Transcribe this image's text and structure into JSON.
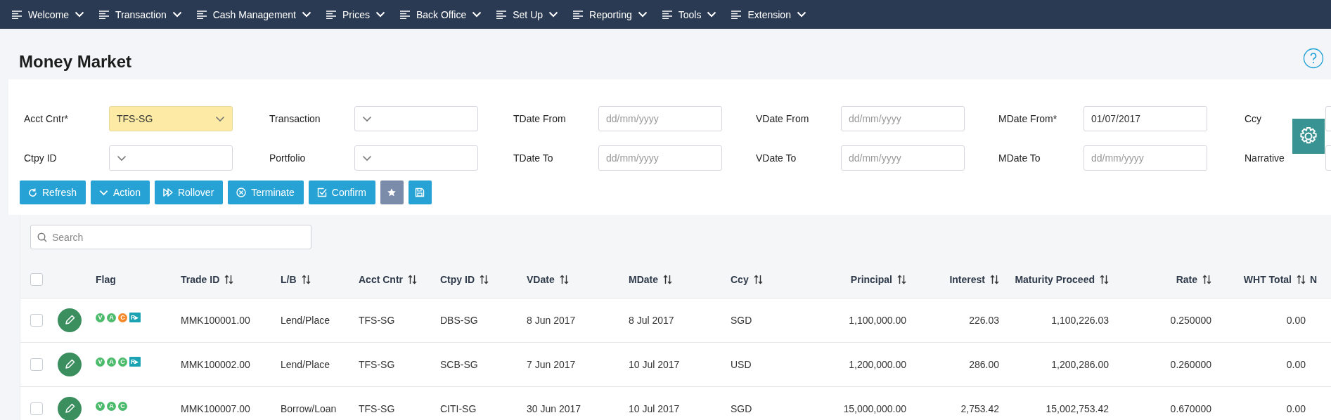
{
  "nav": [
    {
      "label": "Welcome"
    },
    {
      "label": "Transaction"
    },
    {
      "label": "Cash Management"
    },
    {
      "label": "Prices"
    },
    {
      "label": "Back Office"
    },
    {
      "label": "Set Up"
    },
    {
      "label": "Reporting"
    },
    {
      "label": "Tools"
    },
    {
      "label": "Extension"
    }
  ],
  "title": "Money Market",
  "filters": [
    {
      "label": "Acct Cntr*",
      "kind": "select",
      "value": "TFS-SG",
      "highlighted": true
    },
    {
      "label": "Transaction",
      "kind": "select",
      "highlighted": false
    },
    {
      "label": "TDate From",
      "kind": "date",
      "placeholder": "dd/mm/yyyy",
      "highlighted": false
    },
    {
      "label": "VDate From",
      "kind": "date",
      "placeholder": "dd/mm/yyyy",
      "highlighted": false
    },
    {
      "label": "MDate From*",
      "kind": "date",
      "value": "01/07/2017",
      "highlighted": false
    },
    {
      "label": "Ccy",
      "kind": "text",
      "highlighted": false
    },
    {
      "label": "Ctpy ID",
      "kind": "select",
      "highlighted": false
    },
    {
      "label": "Portfolio",
      "kind": "select",
      "highlighted": false
    },
    {
      "label": "TDate To",
      "kind": "date",
      "placeholder": "dd/mm/yyyy",
      "highlighted": false
    },
    {
      "label": "VDate To",
      "kind": "date",
      "placeholder": "dd/mm/yyyy",
      "highlighted": false
    },
    {
      "label": "MDate To",
      "kind": "date",
      "placeholder": "dd/mm/yyyy",
      "highlighted": false
    },
    {
      "label": "Narrative",
      "kind": "text",
      "highlighted": false
    }
  ],
  "buttons": [
    {
      "kind": "refresh",
      "label": "Refresh"
    },
    {
      "kind": "action",
      "label": "Action"
    },
    {
      "kind": "rollover",
      "label": "Rollover"
    },
    {
      "kind": "terminate",
      "label": "Terminate"
    },
    {
      "kind": "confirm",
      "label": "Confirm"
    },
    {
      "kind": "star"
    },
    {
      "kind": "save"
    }
  ],
  "search": {
    "placeholder": "Search"
  },
  "table": {
    "select_all_checked": false,
    "flag_column": {
      "label": "Flag"
    },
    "columns": [
      {
        "label": "Trade ID",
        "sortable": true,
        "numeric": false
      },
      {
        "label": "L/B",
        "sortable": true,
        "numeric": false
      },
      {
        "label": "Acct Cntr",
        "sortable": true,
        "numeric": false
      },
      {
        "label": "Ctpy ID",
        "sortable": true,
        "numeric": false
      },
      {
        "label": "VDate",
        "sortable": true,
        "numeric": false
      },
      {
        "label": "MDate",
        "sortable": true,
        "numeric": false
      },
      {
        "label": "Ccy",
        "sortable": true,
        "numeric": false
      },
      {
        "label": "Principal",
        "sortable": true,
        "numeric": true
      },
      {
        "label": "Interest",
        "sortable": true,
        "numeric": true
      },
      {
        "label": "Maturity Proceed",
        "sortable": true,
        "numeric": true
      },
      {
        "label": "Rate",
        "sortable": true,
        "numeric": true
      },
      {
        "label": "WHT Total",
        "sortable": true,
        "numeric": true
      },
      {
        "label": "N",
        "sortable": false,
        "numeric": false
      }
    ],
    "rows": [
      {
        "checked": false,
        "flags": [
          {
            "kind": "circle",
            "letter": "V",
            "color": "#4cbb6c"
          },
          {
            "kind": "circle",
            "letter": "A",
            "color": "#4cbb6c"
          },
          {
            "kind": "circle",
            "letter": "C",
            "color": "#f5892a"
          },
          {
            "kind": "square",
            "letter": "R▸",
            "color": "#1ba3b3"
          }
        ],
        "cells": [
          "MMK100001.00",
          "Lend/Place",
          "TFS-SG",
          "DBS-SG",
          "8 Jun 2017",
          "8 Jul 2017",
          "SGD",
          "1,100,000.00",
          "226.03",
          "1,100,226.03",
          "0.250000",
          "0.00"
        ]
      },
      {
        "checked": false,
        "flags": [
          {
            "kind": "circle",
            "letter": "V",
            "color": "#4cbb6c"
          },
          {
            "kind": "circle",
            "letter": "A",
            "color": "#4cbb6c"
          },
          {
            "kind": "circle",
            "letter": "C",
            "color": "#4cbb6c"
          },
          {
            "kind": "square",
            "letter": "R▸",
            "color": "#1ba3b3"
          }
        ],
        "cells": [
          "MMK100002.00",
          "Lend/Place",
          "TFS-SG",
          "SCB-SG",
          "7 Jun 2017",
          "10 Jul 2017",
          "USD",
          "1,200,000.00",
          "286.00",
          "1,200,286.00",
          "0.260000",
          "0.00"
        ]
      },
      {
        "checked": false,
        "flags": [
          {
            "kind": "circle",
            "letter": "V",
            "color": "#4cbb6c"
          },
          {
            "kind": "circle",
            "letter": "A",
            "color": "#4cbb6c"
          },
          {
            "kind": "circle",
            "letter": "C",
            "color": "#4cbb6c"
          }
        ],
        "cells": [
          "MMK100007.00",
          "Borrow/Loan",
          "TFS-SG",
          "CITI-SG",
          "30 Jun 2017",
          "10 Jul 2017",
          "SGD",
          "15,000,000.00",
          "2,753.42",
          "15,002,753.42",
          "0.670000",
          "0.00"
        ]
      }
    ]
  }
}
